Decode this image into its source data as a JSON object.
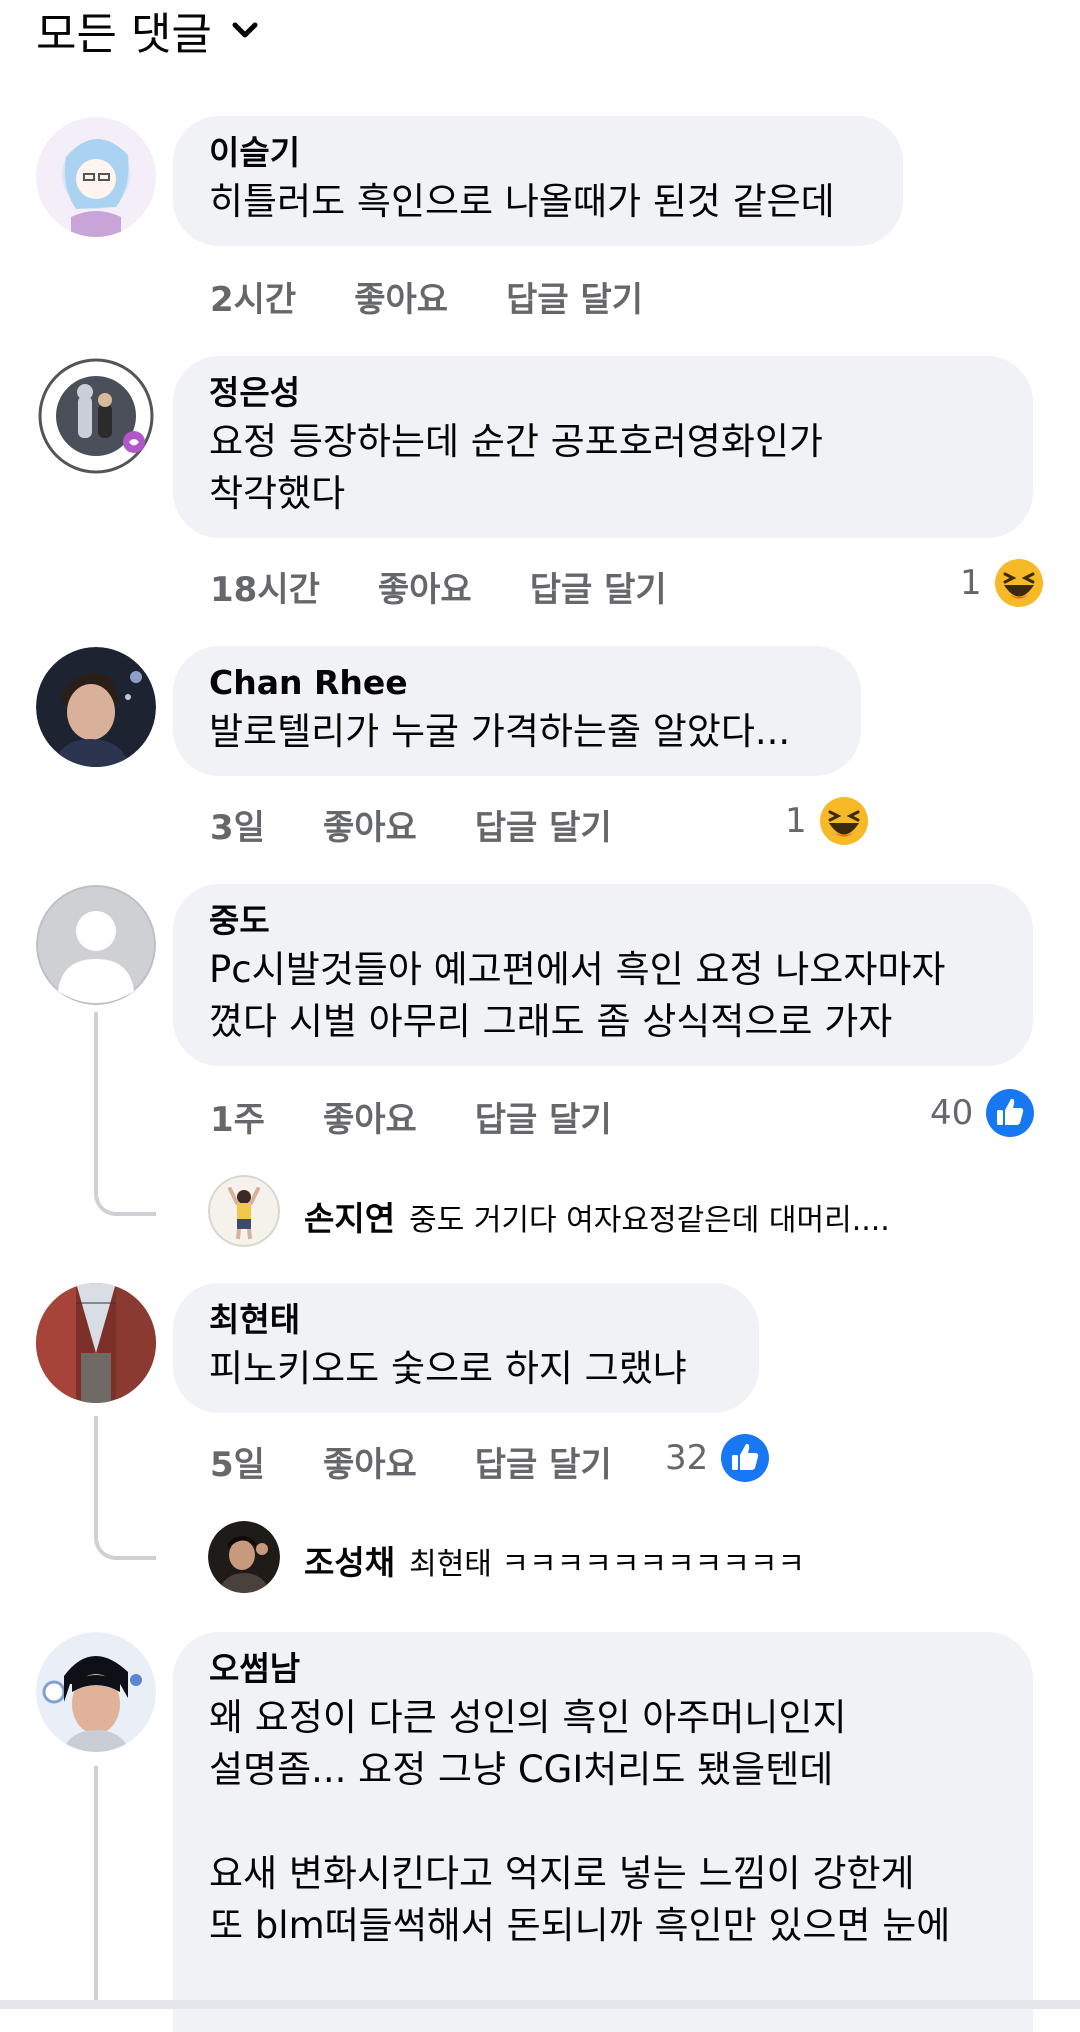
{
  "header": {
    "title": "모든 댓글"
  },
  "colors": {
    "like_blue": "#1877f2",
    "haha_yellow": "#f7b928",
    "bubble_bg": "#f0f2f5",
    "meta_gray": "#65676b"
  },
  "comments": [
    {
      "author": "이슬기",
      "text": "히틀러도 흑인으로 나올때가 된것 같은데",
      "time": "2시간",
      "like": "좋아요",
      "reply": "답글 달기",
      "reaction_count": "",
      "reaction": ""
    },
    {
      "author": "정은성",
      "text": "요정 등장하는데 순간 공포호러영화인가\n착각했다",
      "time": "18시간",
      "like": "좋아요",
      "reply": "답글 달기",
      "reaction_count": "1",
      "reaction": "haha-icon"
    },
    {
      "author": "Chan Rhee",
      "text": "발로텔리가 누굴 가격하는줄 알았다...",
      "time": "3일",
      "like": "좋아요",
      "reply": "답글 달기",
      "reaction_count": "1",
      "reaction": "haha-icon"
    },
    {
      "author": "중도",
      "text": "Pc시발것들아 예고편에서 흑인 요정 나오자마자\n꼈다 시벌 아무리 그래도 좀 상식적으로 가자",
      "time": "1주",
      "like": "좋아요",
      "reply": "답글 달기",
      "reaction_count": "40",
      "reaction": "like-icon"
    },
    {
      "author": "최현태",
      "text": "피노키오도 숯으로 하지 그랬냐",
      "time": "5일",
      "like": "좋아요",
      "reply": "답글 달기",
      "reaction_count": "32",
      "reaction": "like-icon"
    },
    {
      "author": "오썸남",
      "text": "왜 요정이 다큰 성인의 흑인 아주머니인지\n설명좀... 요정 그냥 CGI처리도 됐을텐데\n\n요새 변화시킨다고 억지로 넣는 느낌이 강한게\n또 blm떠들썩해서 돈되니까 흑인만 있으면 눈에",
      "time": "",
      "like": "",
      "reply": "",
      "reaction_count": "",
      "reaction": ""
    }
  ],
  "replies": [
    {
      "author": "손지연",
      "text": "중도 거기다 여자요정같은데 대머리...."
    },
    {
      "author": "조성채",
      "text": "최현태 ㅋㅋㅋㅋㅋㅋㅋㅋㅋㅋㅋ"
    }
  ]
}
